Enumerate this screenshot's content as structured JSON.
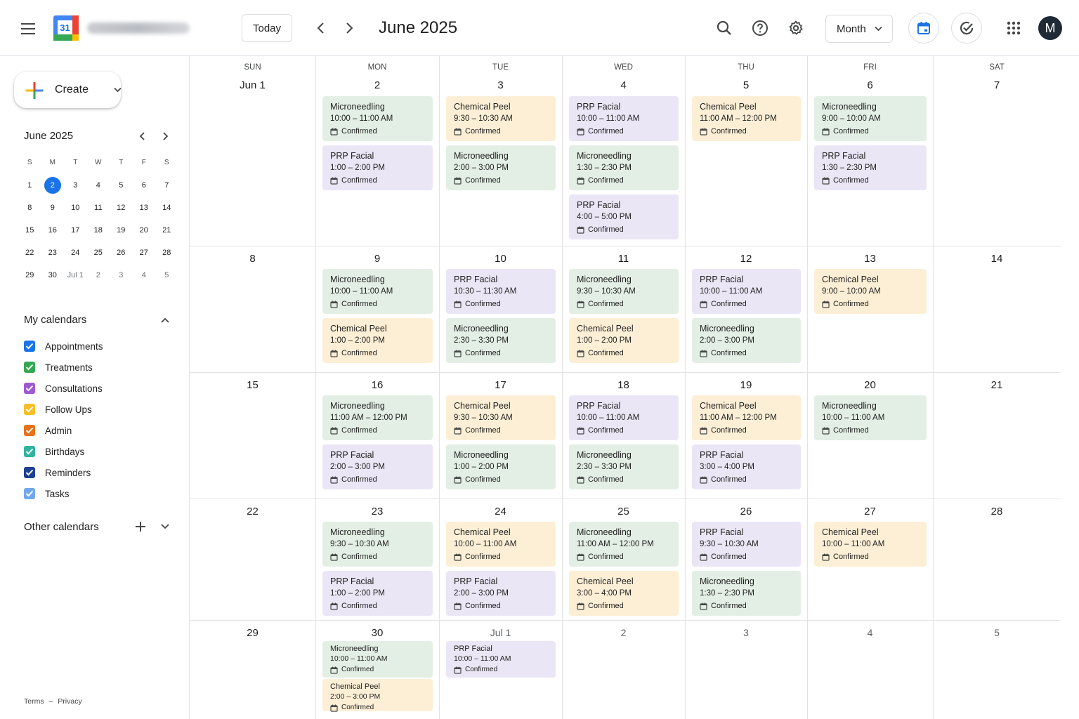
{
  "header": {
    "today_label": "Today",
    "period_title": "June 2025",
    "view_label": "Month",
    "avatar_initial": "M",
    "logo_day": "31",
    "icons": [
      "menu-icon",
      "calendar-logo",
      "chevron-left-icon",
      "chevron-right-icon",
      "search-icon",
      "help-icon",
      "gear-icon",
      "calendar-icon",
      "task-check-icon",
      "apps-grid-icon"
    ]
  },
  "sidebar": {
    "create_label": "Create",
    "mini": {
      "title": "June 2025",
      "weekdays": [
        "S",
        "M",
        "T",
        "W",
        "T",
        "F",
        "S"
      ],
      "weeks": [
        [
          "1",
          "2",
          "3",
          "4",
          "5",
          "6",
          "7"
        ],
        [
          "8",
          "9",
          "10",
          "11",
          "12",
          "13",
          "14"
        ],
        [
          "15",
          "16",
          "17",
          "18",
          "19",
          "20",
          "21"
        ],
        [
          "22",
          "23",
          "24",
          "25",
          "26",
          "27",
          "28"
        ],
        [
          "29",
          "30",
          "Jul 1",
          "2",
          "3",
          "4",
          "5"
        ]
      ],
      "selected": "2"
    },
    "my_calendars_title": "My calendars",
    "calendars": [
      {
        "name": "Appointments",
        "color": "#1a73e8"
      },
      {
        "name": "Treatments",
        "color": "#33a852"
      },
      {
        "name": "Consultations",
        "color": "#9e59d0"
      },
      {
        "name": "Follow Ups",
        "color": "#f6bf26"
      },
      {
        "name": "Admin",
        "color": "#e8711a"
      },
      {
        "name": "Birthdays",
        "color": "#2fb3a0"
      },
      {
        "name": "Reminders",
        "color": "#1d3f94"
      },
      {
        "name": "Tasks",
        "color": "#72a7ee"
      }
    ],
    "other_calendars_title": "Other calendars",
    "footer": {
      "terms": "Terms",
      "separator": "–",
      "privacy": "Privacy"
    }
  },
  "colors": {
    "accent": "#1a73e8",
    "microneedling_bg": "#e3efe4",
    "chemical_peel_bg": "#fdefd6",
    "prp_facial_bg": "#ebe6f6"
  },
  "month": {
    "weekdays": [
      "SUN",
      "MON",
      "TUE",
      "WED",
      "THU",
      "FRI",
      "SAT"
    ],
    "weeks": [
      {
        "days": [
          {
            "label": "Jun 1",
            "events": []
          },
          {
            "label": "2",
            "events": [
              {
                "title": "Microneedling",
                "time": "10:00 – 11:00 AM",
                "status": "Confirmed",
                "kind": "green"
              },
              {
                "title": "PRP Facial",
                "time": "1:00 – 2:00 PM",
                "status": "Confirmed",
                "kind": "purple"
              }
            ]
          },
          {
            "label": "3",
            "events": [
              {
                "title": "Chemical Peel",
                "time": "9:30 – 10:30 AM",
                "status": "Confirmed",
                "kind": "orange"
              },
              {
                "title": "Microneedling",
                "time": "2:00 – 3:00 PM",
                "status": "Confirmed",
                "kind": "green"
              }
            ]
          },
          {
            "label": "4",
            "events": [
              {
                "title": "PRP Facial",
                "time": "10:00 – 11:00 AM",
                "status": "Confirmed",
                "kind": "purple"
              },
              {
                "title": "Microneedling",
                "time": "1:30 – 2:30 PM",
                "status": "Confirmed",
                "kind": "green"
              },
              {
                "title": "PRP Facial",
                "time": "4:00 – 5:00 PM",
                "status": "Confirmed",
                "kind": "purple"
              }
            ]
          },
          {
            "label": "5",
            "events": [
              {
                "title": "Chemical Peel",
                "time": "11:00 AM – 12:00 PM",
                "status": "Confirmed",
                "kind": "orange"
              }
            ]
          },
          {
            "label": "6",
            "events": [
              {
                "title": "Microneedling",
                "time": "9:00 – 10:00 AM",
                "status": "Confirmed",
                "kind": "green"
              },
              {
                "title": "PRP Facial",
                "time": "1:30 – 2:30 PM",
                "status": "Confirmed",
                "kind": "purple"
              }
            ]
          },
          {
            "label": "7",
            "events": []
          }
        ]
      },
      {
        "days": [
          {
            "label": "8",
            "events": []
          },
          {
            "label": "9",
            "events": [
              {
                "title": "Microneedling",
                "time": "10:00 – 11:00 AM",
                "status": "Confirmed",
                "kind": "green"
              },
              {
                "title": "Chemical Peel",
                "time": "1:00 – 2:00 PM",
                "status": "Confirmed",
                "kind": "orange"
              }
            ]
          },
          {
            "label": "10",
            "events": [
              {
                "title": "PRP Facial",
                "time": "10:30 – 11:30 AM",
                "status": "Confirmed",
                "kind": "purple"
              },
              {
                "title": "Microneedling",
                "time": "2:30 – 3:30 PM",
                "status": "Confirmed",
                "kind": "green"
              }
            ]
          },
          {
            "label": "11",
            "events": [
              {
                "title": "Microneedling",
                "time": "9:30 – 10:30 AM",
                "status": "Confirmed",
                "kind": "green"
              },
              {
                "title": "Chemical Peel",
                "time": "1:00 – 2:00 PM",
                "status": "Confirmed",
                "kind": "orange"
              }
            ]
          },
          {
            "label": "12",
            "events": [
              {
                "title": "PRP Facial",
                "time": "10:00 – 11:00 AM",
                "status": "Confirmed",
                "kind": "purple"
              },
              {
                "title": "Microneedling",
                "time": "2:00 – 3:00 PM",
                "status": "Confirmed",
                "kind": "green"
              }
            ]
          },
          {
            "label": "13",
            "events": [
              {
                "title": "Chemical Peel",
                "time": "9:00 – 10:00 AM",
                "status": "Confirmed",
                "kind": "orange"
              }
            ]
          },
          {
            "label": "14",
            "events": []
          }
        ]
      },
      {
        "days": [
          {
            "label": "15",
            "events": []
          },
          {
            "label": "16",
            "events": [
              {
                "title": "Microneedling",
                "time": "11:00 AM – 12:00 PM",
                "status": "Confirmed",
                "kind": "green"
              },
              {
                "title": "PRP Facial",
                "time": "2:00 – 3:00 PM",
                "status": "Confirmed",
                "kind": "purple"
              }
            ]
          },
          {
            "label": "17",
            "events": [
              {
                "title": "Chemical Peel",
                "time": "9:30 – 10:30 AM",
                "status": "Confirmed",
                "kind": "orange"
              },
              {
                "title": "Microneedling",
                "time": "1:00 – 2:00 PM",
                "status": "Confirmed",
                "kind": "green"
              }
            ]
          },
          {
            "label": "18",
            "events": [
              {
                "title": "PRP Facial",
                "time": "10:00 – 11:00 AM",
                "status": "Confirmed",
                "kind": "purple"
              },
              {
                "title": "Microneedling",
                "time": "2:30 – 3:30 PM",
                "status": "Confirmed",
                "kind": "green"
              }
            ]
          },
          {
            "label": "19",
            "events": [
              {
                "title": "Chemical Peel",
                "time": "11:00 AM – 12:00 PM",
                "status": "Confirmed",
                "kind": "orange"
              },
              {
                "title": "PRP Facial",
                "time": "3:00 – 4:00 PM",
                "status": "Confirmed",
                "kind": "purple"
              }
            ]
          },
          {
            "label": "20",
            "events": [
              {
                "title": "Microneedling",
                "time": "10:00 – 11:00 AM",
                "status": "Confirmed",
                "kind": "green"
              }
            ]
          },
          {
            "label": "21",
            "events": []
          }
        ]
      },
      {
        "days": [
          {
            "label": "22",
            "events": []
          },
          {
            "label": "23",
            "events": [
              {
                "title": "Microneedling",
                "time": "9:30 – 10:30 AM",
                "status": "Confirmed",
                "kind": "green"
              },
              {
                "title": "PRP Facial",
                "time": "1:00 – 2:00 PM",
                "status": "Confirmed",
                "kind": "purple"
              }
            ]
          },
          {
            "label": "24",
            "events": [
              {
                "title": "Chemical Peel",
                "time": "10:00 – 11:00 AM",
                "status": "Confirmed",
                "kind": "orange"
              },
              {
                "title": "PRP Facial",
                "time": "2:00 – 3:00 PM",
                "status": "Confirmed",
                "kind": "purple"
              }
            ]
          },
          {
            "label": "25",
            "events": [
              {
                "title": "Microneedling",
                "time": "11:00 AM – 12:00 PM",
                "status": "Confirmed",
                "kind": "green"
              },
              {
                "title": "Chemical Peel",
                "time": "3:00 – 4:00 PM",
                "status": "Confirmed",
                "kind": "orange"
              }
            ]
          },
          {
            "label": "26",
            "events": [
              {
                "title": "PRP Facial",
                "time": "9:30 – 10:30 AM",
                "status": "Confirmed",
                "kind": "purple"
              },
              {
                "title": "Microneedling",
                "time": "1:30 – 2:30 PM",
                "status": "Confirmed",
                "kind": "green"
              }
            ]
          },
          {
            "label": "27",
            "events": [
              {
                "title": "Chemical Peel",
                "time": "10:00 – 11:00 AM",
                "status": "Confirmed",
                "kind": "orange"
              }
            ]
          },
          {
            "label": "28",
            "events": []
          }
        ]
      },
      {
        "days": [
          {
            "label": "29",
            "events": []
          },
          {
            "label": "30",
            "events": [
              {
                "title": "Microneedling",
                "time": "10:00 – 11:00 AM",
                "status": "Confirmed",
                "kind": "green"
              },
              {
                "title": "Chemical Peel",
                "time": "2:00 – 3:00 PM",
                "status": "Confirmed",
                "kind": "orange"
              }
            ]
          },
          {
            "label": "Jul 1",
            "other": true,
            "events": [
              {
                "title": "PRP Facial",
                "time": "10:00 – 11:00 AM",
                "status": "Confirmed",
                "kind": "purple"
              }
            ]
          },
          {
            "label": "2",
            "other": true,
            "events": []
          },
          {
            "label": "3",
            "other": true,
            "events": []
          },
          {
            "label": "4",
            "other": true,
            "events": []
          },
          {
            "label": "5",
            "other": true,
            "events": []
          }
        ]
      }
    ]
  }
}
